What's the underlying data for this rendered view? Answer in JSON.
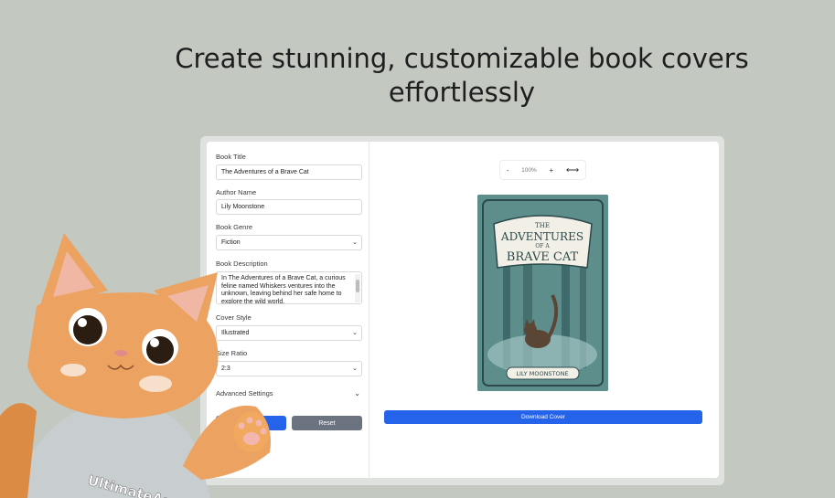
{
  "headline": {
    "line1": "Create stunning, customizable book covers",
    "line2": "effortlessly"
  },
  "form": {
    "book_title_label": "Book Title",
    "book_title_value": "The Adventures of a Brave Cat",
    "author_label": "Author Name",
    "author_value": "Lily Moonstone",
    "genre_label": "Book Genre",
    "genre_value": "Fiction",
    "description_label": "Book Description",
    "description_value": "In The Adventures of a Brave Cat, a curious feline named Whiskers ventures into the unknown, leaving behind her safe home to explore the wild world.",
    "style_label": "Cover Style",
    "style_value": "Illustrated",
    "ratio_label": "Size Ratio",
    "ratio_value": "2:3",
    "advanced_label": "Advanced Settings",
    "reset_label": "Reset"
  },
  "preview": {
    "zoom_out": "-",
    "zoom_level": "100%",
    "zoom_in": "+",
    "fit_icon": "fit-width-icon",
    "download_label": "Download Cover"
  },
  "cover": {
    "title_line1": "THE",
    "title_line2": "ADVENTURES",
    "title_line3": "OF A",
    "title_line4": "BRAVE CAT",
    "author": "LILY MOONSTONE"
  },
  "mascot": {
    "shirt_text": "UltimateApp"
  },
  "colors": {
    "background": "#c3c8c1",
    "accent": "#2563eb",
    "reset": "#6b7280",
    "cover_bg": "#5e8e8c"
  }
}
